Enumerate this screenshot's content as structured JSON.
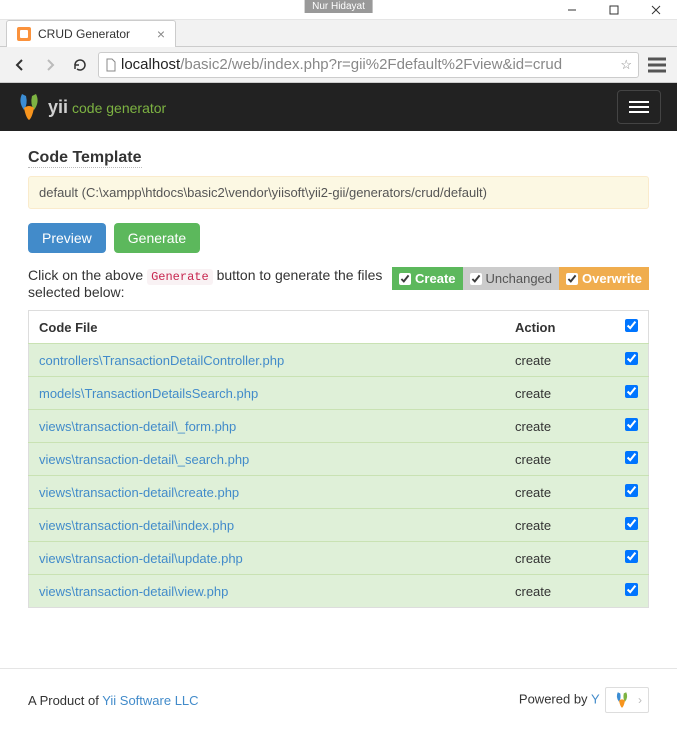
{
  "window": {
    "badge": "Nur Hidayat"
  },
  "browser": {
    "tab_title": "CRUD Generator",
    "url_host": "localhost",
    "url_path": "/basic2/web/index.php?r=gii%2Fdefault%2Fview&id=crud"
  },
  "navbar": {
    "brand_main": "yii",
    "brand_sub": "code generator"
  },
  "section": {
    "title": "Code Template",
    "template_path": "default (C:\\xampp\\htdocs\\basic2\\vendor\\yiisoft\\yii2-gii/generators/crud/default)"
  },
  "buttons": {
    "preview": "Preview",
    "generate": "Generate"
  },
  "instruction": {
    "part1": "Click on the above",
    "code": "Generate",
    "part2": "button to generate the files selected below:"
  },
  "legend": {
    "create": "Create",
    "unchanged": "Unchanged",
    "overwrite": "Overwrite"
  },
  "table": {
    "headers": {
      "file": "Code File",
      "action": "Action"
    },
    "rows": [
      {
        "file": "controllers\\TransactionDetailController.php",
        "action": "create"
      },
      {
        "file": "models\\TransactionDetailsSearch.php",
        "action": "create"
      },
      {
        "file": "views\\transaction-detail\\_form.php",
        "action": "create"
      },
      {
        "file": "views\\transaction-detail\\_search.php",
        "action": "create"
      },
      {
        "file": "views\\transaction-detail\\create.php",
        "action": "create"
      },
      {
        "file": "views\\transaction-detail\\index.php",
        "action": "create"
      },
      {
        "file": "views\\transaction-detail\\update.php",
        "action": "create"
      },
      {
        "file": "views\\transaction-detail\\view.php",
        "action": "create"
      }
    ]
  },
  "footer": {
    "product_prefix": "A Product of ",
    "product_link": "Yii Software LLC",
    "powered_prefix": "Powered by ",
    "powered_link": "Y"
  }
}
